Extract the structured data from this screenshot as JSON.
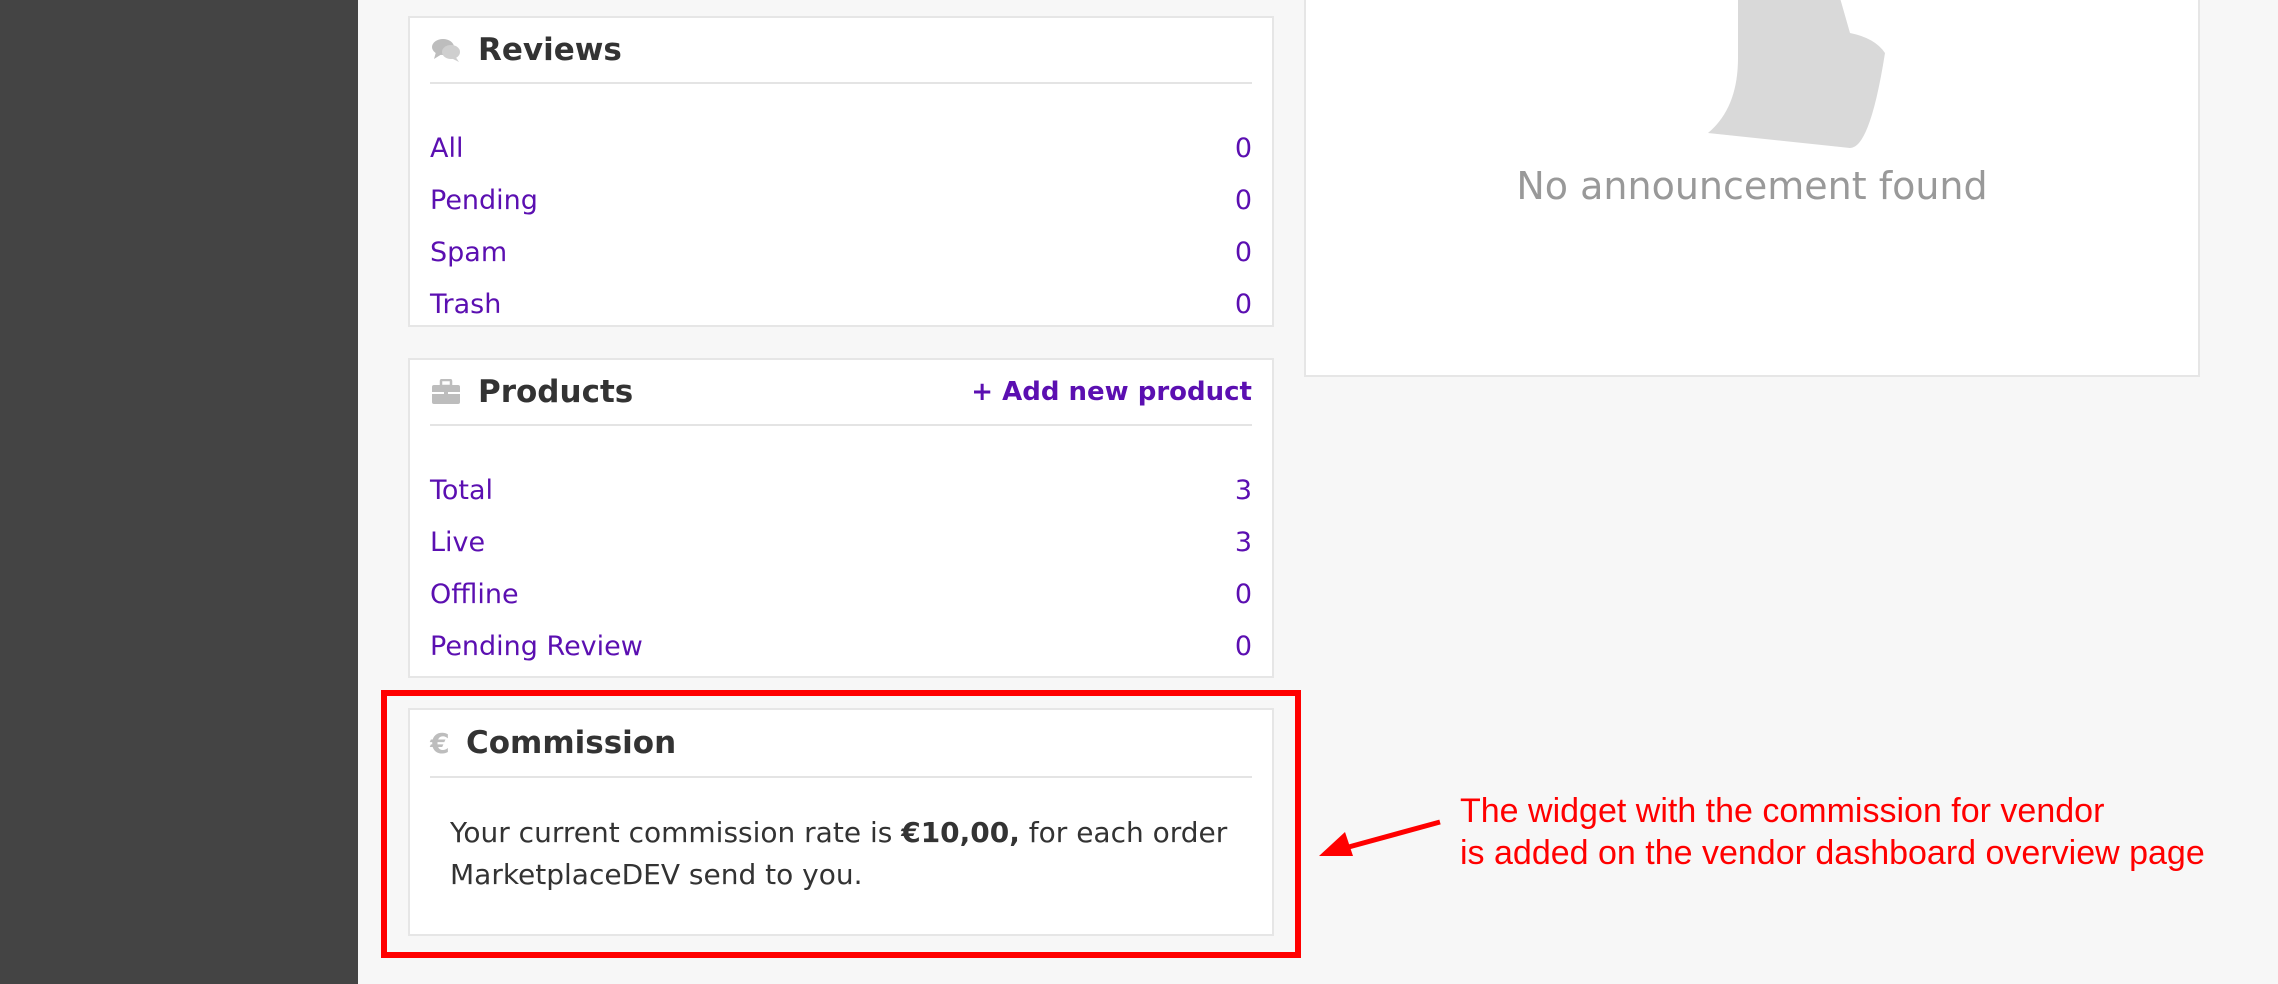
{
  "reviews": {
    "title": "Reviews",
    "items": [
      {
        "label": "All",
        "count": "0"
      },
      {
        "label": "Pending",
        "count": "0"
      },
      {
        "label": "Spam",
        "count": "0"
      },
      {
        "label": "Trash",
        "count": "0"
      }
    ]
  },
  "products": {
    "title": "Products",
    "add_link": "+ Add new product",
    "items": [
      {
        "label": "Total",
        "count": "3"
      },
      {
        "label": "Live",
        "count": "3"
      },
      {
        "label": "Offline",
        "count": "0"
      },
      {
        "label": "Pending Review",
        "count": "0"
      }
    ]
  },
  "commission": {
    "icon_char": "€",
    "title": "Commission",
    "text_before": "Your current commission rate is ",
    "rate": "€10,00,",
    "text_after": " for each order MarketplaceDEV send to you."
  },
  "announcements": {
    "empty_text": "No announcement found"
  },
  "annotation": {
    "line1": "The widget with the commission for vendor",
    "line2": "is added on the vendor dashboard overview page"
  },
  "colors": {
    "link": "#5b0fb1",
    "sidebar": "#444444",
    "highlight": "#ff0000"
  }
}
